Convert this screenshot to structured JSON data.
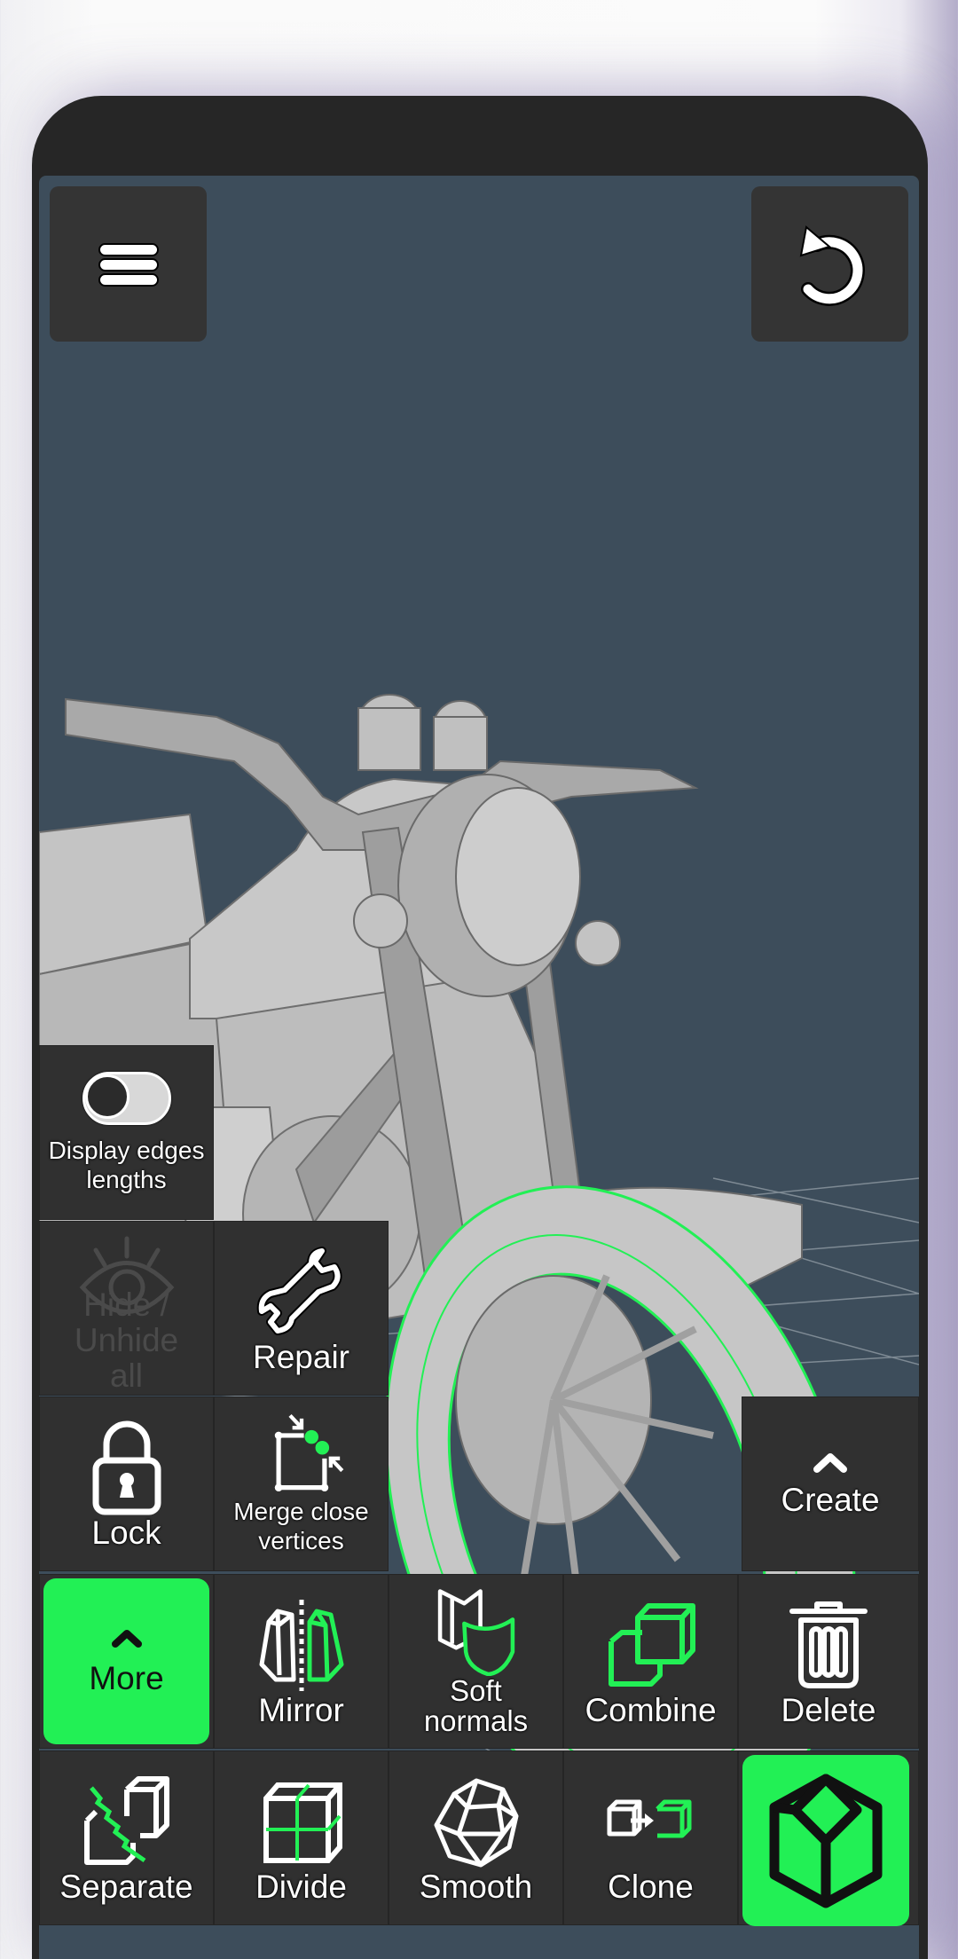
{
  "toolbar": {
    "menu_icon": "hamburger-menu-icon",
    "undo_icon": "undo-icon"
  },
  "viewport": {
    "scene": "3D low-poly motorcycle model, front wheel selected",
    "background_color": "#3d4d5b",
    "selection_color": "#22f055"
  },
  "panel": {
    "display_edges": {
      "label_line1": "Display edges",
      "label_line2": "lengths",
      "toggle_on": false,
      "icon": "toggle-switch-icon"
    },
    "hide_unhide": {
      "label_line1": "Hide /",
      "label_line2": "Unhide",
      "label_line3": "all",
      "icon": "eye-icon",
      "disabled": true
    },
    "repair": {
      "label": "Repair",
      "icon": "wrench-icon"
    },
    "lock": {
      "label": "Lock",
      "icon": "lock-icon"
    },
    "merge": {
      "label_line1": "Merge close",
      "label_line2": "vertices",
      "icon": "merge-vertices-icon"
    },
    "create": {
      "label": "Create",
      "icon": "chevron-up-icon"
    },
    "more": {
      "label": "More",
      "icon": "chevron-up-icon"
    },
    "mirror": {
      "label": "Mirror",
      "icon": "mirror-icon"
    },
    "soft_normals": {
      "label_line1": "Soft",
      "label_line2": "normals",
      "icon": "soft-normals-icon"
    },
    "combine": {
      "label": "Combine",
      "icon": "combine-icon"
    },
    "delete": {
      "label": "Delete",
      "icon": "trash-icon"
    },
    "separate": {
      "label": "Separate",
      "icon": "separate-icon"
    },
    "divide": {
      "label": "Divide",
      "icon": "divide-icon"
    },
    "smooth": {
      "label": "Smooth",
      "icon": "smooth-icon"
    },
    "clone": {
      "label": "Clone",
      "icon": "clone-icon"
    },
    "object_mode": {
      "icon": "cube-icon",
      "active": true
    }
  },
  "colors": {
    "accent": "#22f055",
    "panel_bg": "#303030",
    "frame": "#262626"
  }
}
